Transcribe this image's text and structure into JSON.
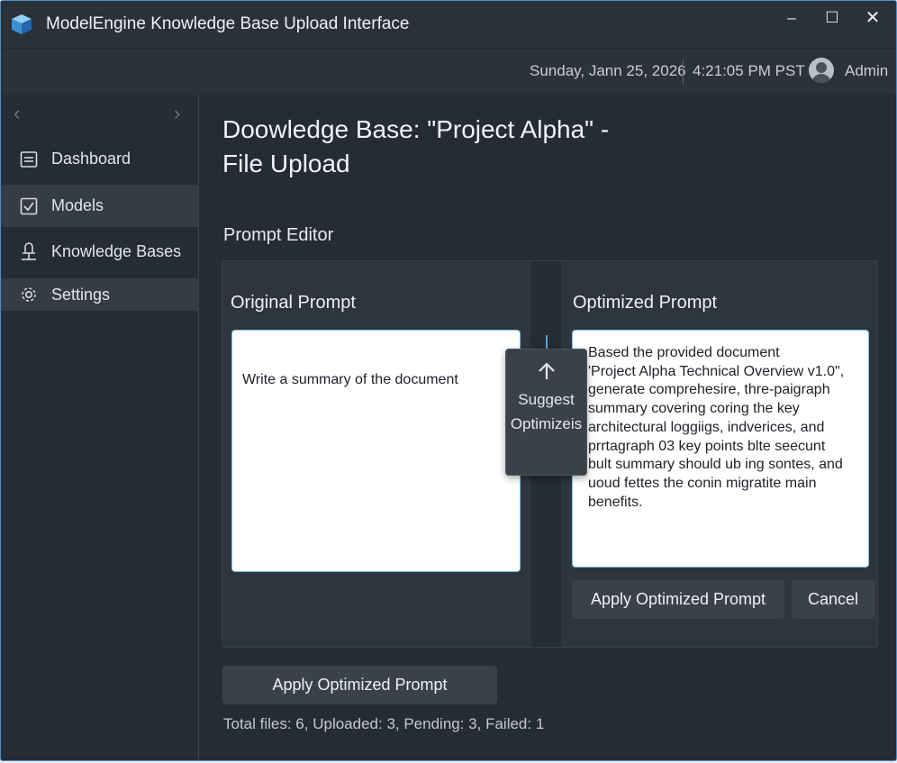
{
  "window": {
    "title": "ModelEngine Knowledge Base Upload Interface",
    "controls": {
      "minimize": "–",
      "maximize": "☐",
      "close": "✕"
    }
  },
  "header": {
    "date": "Sunday, Jann 25, 2026",
    "time": "4:21:05 PM PST",
    "user": "Admin",
    "avatar_icon": "user-avatar-icon"
  },
  "sidebar": {
    "collapse_left": "‹",
    "collapse_right": "›",
    "items": [
      {
        "label": "Dashboard",
        "icon": "dashboard-icon",
        "active": false
      },
      {
        "label": "Models",
        "icon": "checkbox-icon",
        "active": true
      },
      {
        "label": "Knowledge Bases",
        "icon": "knowledge-base-icon",
        "active": false
      },
      {
        "label": "Settings",
        "icon": "gear-icon",
        "active": true
      }
    ]
  },
  "main": {
    "title_line1": "Doowledge Base: \"Project Alpha\" -",
    "title_line2": "File Upload",
    "section_label": "Prompt Editor",
    "editor": {
      "original": {
        "title": "Original Prompt",
        "text": "Write a summary of the document"
      },
      "suggest": {
        "label_line1": "Suggest",
        "label_line2": "Optimizeis",
        "icon": "arrow-up-icon"
      },
      "optimized": {
        "title": "Optimized Prompt",
        "lines": [
          "Based the provided document",
          "'Project Alpha Technical Overview v1.0\",",
          "generate comprehesire, thre-paigraph",
          "summary covering coring the key",
          "architectural loggiigs, indverices, and",
          "prrtagraph 03 key points blte seecunt",
          "bult summary should ub ing sontes, and",
          "uoud fettes the conin migratite main",
          "benefits."
        ],
        "apply_label": "Apply Optimized Prompt",
        "cancel_label": "Cancel"
      }
    },
    "apply_button": "Apply Optimized Prompt",
    "status": "Total files: 6, Uploaded: 3, Pending: 3, Failed: 1"
  },
  "colors": {
    "window_bg": "#262c35",
    "panel_bg": "#2f353e",
    "accent_border": "#7ec4ea",
    "button_bg": "#3a414a"
  }
}
